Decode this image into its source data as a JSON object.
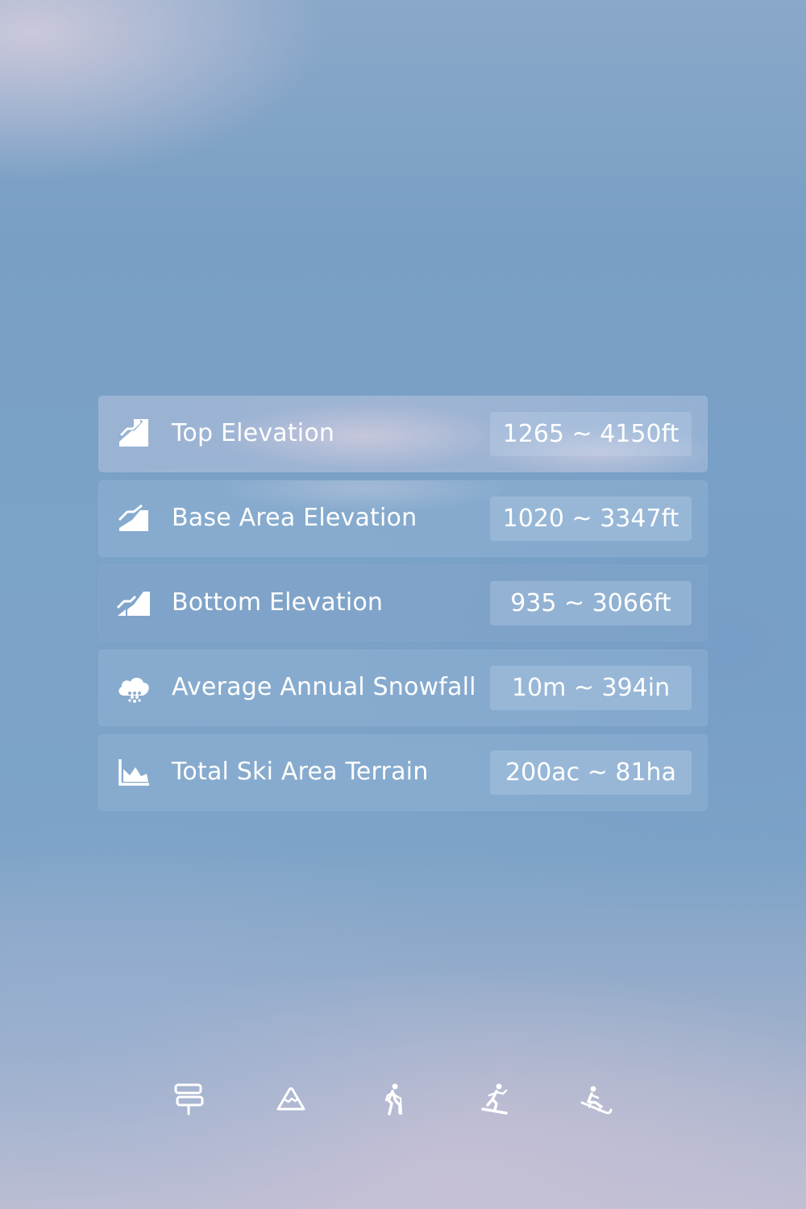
{
  "stats": [
    {
      "icon": "top-elevation-icon",
      "label": "Top Elevation",
      "value": "1265 ~ 4150ft"
    },
    {
      "icon": "base-area-elevation-icon",
      "label": "Base Area Elevation",
      "value": "1020 ~ 3347ft"
    },
    {
      "icon": "bottom-elevation-icon",
      "label": "Bottom Elevation",
      "value": "935 ~ 3066ft"
    },
    {
      "icon": "snowfall-cloud-icon",
      "label": "Average Annual Snowfall",
      "value": "10m ~ 394in"
    },
    {
      "icon": "terrain-area-chart-icon",
      "label": "Total Ski Area Terrain",
      "value": "200ac ~ 81ha"
    }
  ],
  "bottom_nav": [
    {
      "icon": "signpost-icon"
    },
    {
      "icon": "mountain-icon"
    },
    {
      "icon": "hiker-icon"
    },
    {
      "icon": "snowboarder-icon"
    },
    {
      "icon": "sledding-icon"
    }
  ],
  "colors": {
    "text": "#ffffff",
    "background_top": "#8aa8c9",
    "background_mid": "#7ba2c7",
    "background_bottom": "#bdbfd3"
  }
}
